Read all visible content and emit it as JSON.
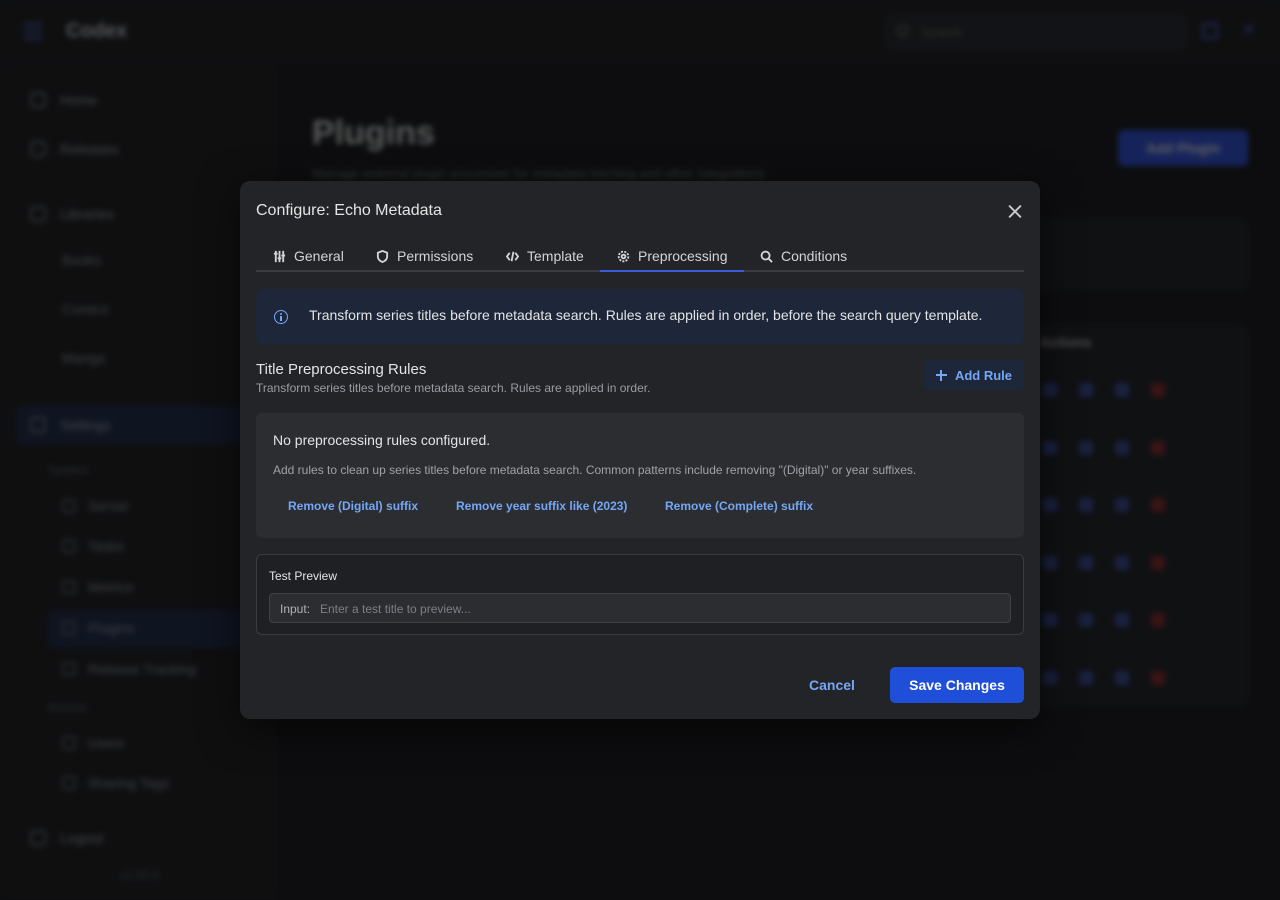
{
  "background": {
    "app_title": "Codex",
    "search_placeholder": "Search",
    "nav": {
      "home": "Home",
      "releases": "Releases",
      "libraries": "Libraries",
      "libraries_children": [
        "Books",
        "Comics",
        "Manga"
      ],
      "settings": "Settings",
      "system_section": "System",
      "system_items": [
        "Server",
        "Tasks",
        "Metrics",
        "Plugins",
        "Release Tracking"
      ],
      "access_section": "Access",
      "access_items": [
        "Users",
        "Sharing Tags"
      ],
      "logout": "Logout",
      "version": "v1.00.0"
    },
    "page_title": "Plugins",
    "page_subtitle": "Manage external plugin processes for metadata fetching and other integrations",
    "add_plugin_label": "Add Plugin",
    "table_header_actions": "Actions"
  },
  "modal": {
    "title": "Configure: Echo Metadata",
    "tabs": [
      {
        "label": "General",
        "icon": "sliders-icon"
      },
      {
        "label": "Permissions",
        "icon": "shield-icon"
      },
      {
        "label": "Template",
        "icon": "code-icon"
      },
      {
        "label": "Preprocessing",
        "icon": "gear-icon",
        "active": true
      },
      {
        "label": "Conditions",
        "icon": "search-icon"
      }
    ],
    "info_text": "Transform series titles before metadata search. Rules are applied in order, before the search query template.",
    "rules": {
      "title": "Title Preprocessing Rules",
      "subtitle": "Transform series titles before metadata search. Rules are applied in order.",
      "add_rule_label": "Add Rule"
    },
    "empty": {
      "title": "No preprocessing rules configured.",
      "description": "Add rules to clean up series titles before metadata search. Common patterns include removing \"(Digital)\" or year suffixes.",
      "presets": [
        "Remove (Digital) suffix",
        "Remove year suffix like (2023)",
        "Remove (Complete) suffix"
      ]
    },
    "test_preview": {
      "title": "Test Preview",
      "input_label": "Input:",
      "input_placeholder": "Enter a test title to preview...",
      "input_value": ""
    },
    "cancel_label": "Cancel",
    "save_label": "Save Changes"
  },
  "colors": {
    "accent": "#3b5bdb",
    "link": "#74a7f5",
    "primary_button": "#1f4fd8",
    "modal_bg": "#232427"
  }
}
